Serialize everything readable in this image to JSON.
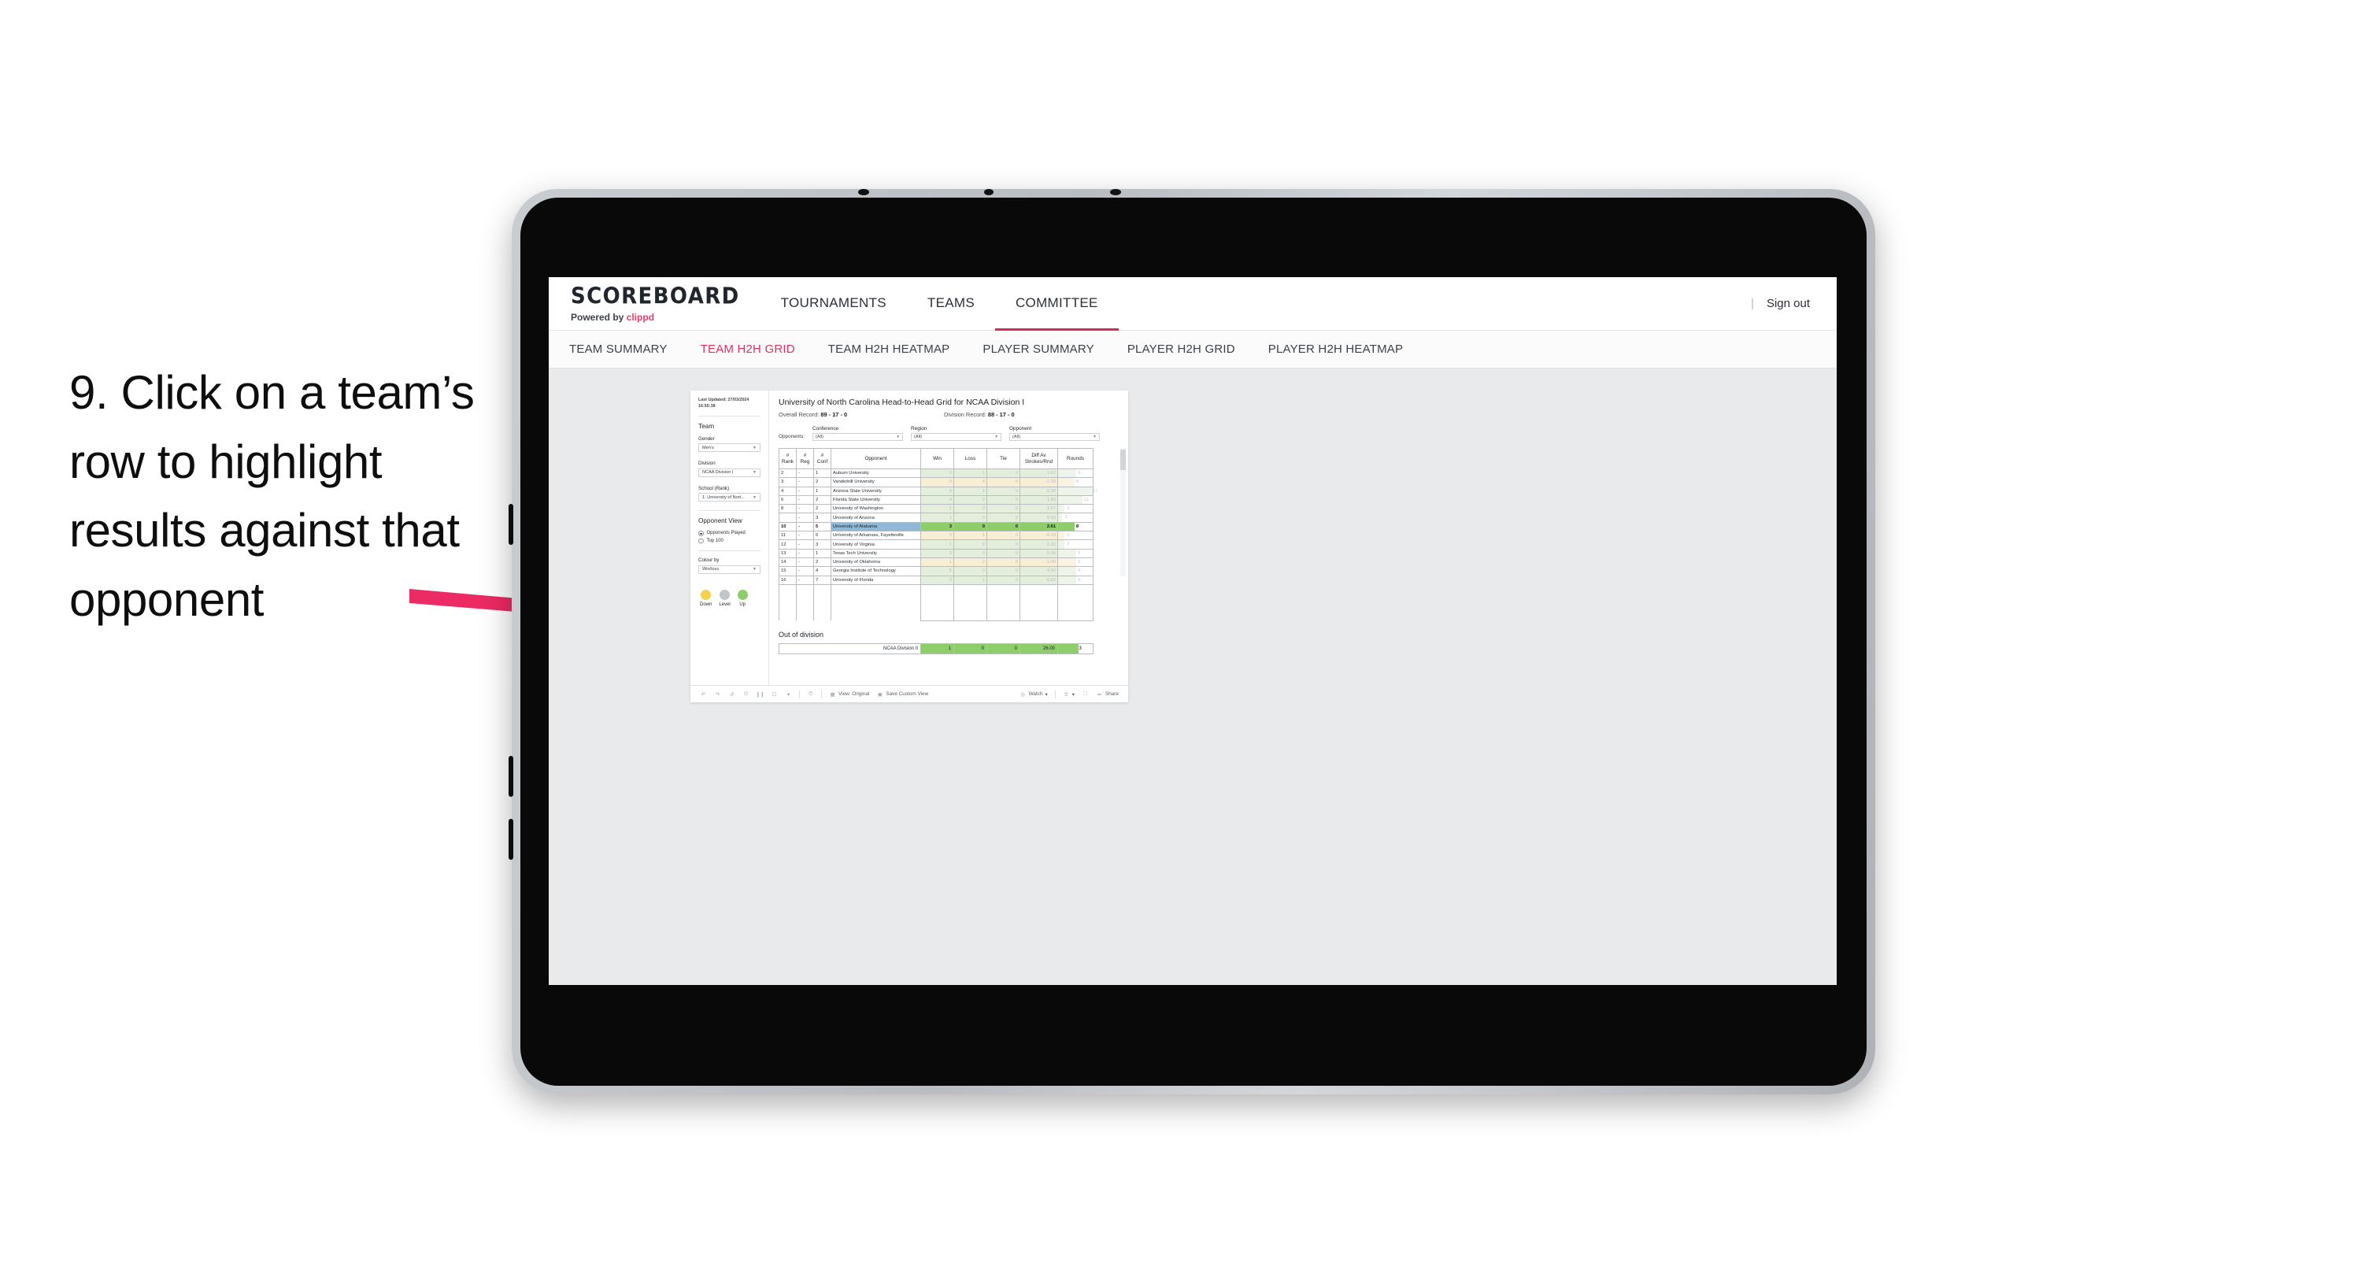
{
  "instruction": "9. Click on a team’s row to highlight results against that opponent",
  "accent": {
    "brand_pink": "#d92a55",
    "arrow_pink": "#ec2a63",
    "select_blue": "#8fb9d6",
    "win_green": "#8ece6a",
    "loss_yellow": "#f4e7c3"
  },
  "topnav": {
    "brand": "SCOREBOARD",
    "powered_prefix": "Powered by ",
    "powered_brand": "clippd",
    "items": [
      {
        "label": "TOURNAMENTS",
        "active": false
      },
      {
        "label": "TEAMS",
        "active": false
      },
      {
        "label": "COMMITTEE",
        "active": true
      }
    ],
    "divider": "|",
    "signout": "Sign out"
  },
  "subnav": {
    "items": [
      {
        "label": "TEAM SUMMARY",
        "active": false
      },
      {
        "label": "TEAM H2H GRID",
        "active": true
      },
      {
        "label": "TEAM H2H HEATMAP",
        "active": false
      },
      {
        "label": "PLAYER SUMMARY",
        "active": false
      },
      {
        "label": "PLAYER H2H GRID",
        "active": false
      },
      {
        "label": "PLAYER H2H HEATMAP",
        "active": false
      }
    ]
  },
  "sidebar": {
    "last_updated_label": "Last Updated:",
    "last_updated_date": "27/03/2024",
    "last_updated_time": "16:55:38",
    "team_section": "Team",
    "gender_label": "Gender",
    "gender_value": "Men’s",
    "division_label": "Division",
    "division_value": "NCAA Division I",
    "school_label": "School (Rank)",
    "school_value": "1. University of Nort...",
    "opponent_view_label": "Opponent View",
    "opponent_view_options": [
      {
        "label": "Opponents Played",
        "selected": true
      },
      {
        "label": "Top 100",
        "selected": false
      }
    ],
    "colour_by_label": "Colour by",
    "colour_by_value": "Win/loss",
    "legend": [
      {
        "label": "Down",
        "color": "#f5d14e"
      },
      {
        "label": "Level",
        "color": "#c3c6c9"
      },
      {
        "label": "Up",
        "color": "#8ece6a"
      }
    ]
  },
  "main": {
    "title": "University of North Carolina Head-to-Head Grid for NCAA Division I",
    "overall_record_label": "Overall Record:",
    "overall_record_value": "89 - 17 - 0",
    "division_record_label": "Division Record:",
    "division_record_value": "88 - 17 - 0",
    "opponents_label": "Opponents:",
    "filters": [
      {
        "label": "Conference",
        "value": "(All)"
      },
      {
        "label": "Region",
        "value": "(All)"
      },
      {
        "label": "Opponent",
        "value": "(All)"
      }
    ],
    "out_of_division_label": "Out of division"
  },
  "chart_data": {
    "type": "table",
    "title": "University of North Carolina Head-to-Head Grid for NCAA Division I",
    "columns": [
      "# Rank",
      "# Reg",
      "# Conf",
      "Opponent",
      "Win",
      "Loss",
      "Tie",
      "Diff Av Strokes/Rnd",
      "Rounds"
    ],
    "column_headers_multiline": [
      [
        "#",
        "Rank"
      ],
      [
        "#",
        "Reg"
      ],
      [
        "#",
        "Conf"
      ],
      [
        "Opponent"
      ],
      [
        "Win"
      ],
      [
        "Loss"
      ],
      [
        "Tie"
      ],
      [
        "Diff Av",
        "Strokes/Rnd"
      ],
      [
        "Rounds"
      ]
    ],
    "rows": [
      {
        "rank": "2",
        "reg": "-",
        "conf": "1",
        "opponent": "Auburn University",
        "win": "2",
        "loss": "1",
        "tie": "0",
        "diff": "1.67",
        "rounds": "9",
        "result": "up",
        "selected": false
      },
      {
        "rank": "3",
        "reg": "-",
        "conf": "2",
        "opponent": "Vanderbilt University",
        "win": "0",
        "loss": "4",
        "tie": "0",
        "diff": "-2.29",
        "rounds": "8",
        "result": "down",
        "selected": false
      },
      {
        "rank": "4",
        "reg": "-",
        "conf": "1",
        "opponent": "Arizona State University",
        "win": "5",
        "loss": "1",
        "tie": "0",
        "diff": "2.28",
        "rounds": "17",
        "result": "up",
        "selected": false
      },
      {
        "rank": "6",
        "reg": "-",
        "conf": "2",
        "opponent": "Florida State University",
        "win": "4",
        "loss": "2",
        "tie": "0",
        "diff": "1.83",
        "rounds": "12",
        "result": "up",
        "selected": false
      },
      {
        "rank": "8",
        "reg": "-",
        "conf": "2",
        "opponent": "University of Washington",
        "win": "1",
        "loss": "0",
        "tie": "0",
        "diff": "3.67",
        "rounds": "3",
        "result": "up",
        "selected": false
      },
      {
        "rank": "",
        "reg": "-",
        "conf": "3",
        "opponent": "University of Arizona",
        "win": "1",
        "loss": "0",
        "tie": "0",
        "diff": "9.00",
        "rounds": "2",
        "result": "up",
        "selected": false
      },
      {
        "rank": "10",
        "reg": "-",
        "conf": "5",
        "opponent": "University of Alabama",
        "win": "3",
        "loss": "0",
        "tie": "0",
        "diff": "2.61",
        "rounds": "8",
        "result": "up",
        "selected": true
      },
      {
        "rank": "11",
        "reg": "-",
        "conf": "6",
        "opponent": "University of Arkansas, Fayetteville",
        "win": "0",
        "loss": "1",
        "tie": "0",
        "diff": "-4.33",
        "rounds": "3",
        "result": "down",
        "selected": false
      },
      {
        "rank": "12",
        "reg": "-",
        "conf": "3",
        "opponent": "University of Virginia",
        "win": "1",
        "loss": "0",
        "tie": "0",
        "diff": "2.33",
        "rounds": "3",
        "result": "up",
        "selected": false
      },
      {
        "rank": "13",
        "reg": "-",
        "conf": "1",
        "opponent": "Texas Tech University",
        "win": "3",
        "loss": "0",
        "tie": "0",
        "diff": "5.56",
        "rounds": "9",
        "result": "up",
        "selected": false
      },
      {
        "rank": "14",
        "reg": "-",
        "conf": "2",
        "opponent": "University of Oklahoma",
        "win": "1",
        "loss": "2",
        "tie": "0",
        "diff": "-1.00",
        "rounds": "9",
        "result": "down",
        "selected": false
      },
      {
        "rank": "15",
        "reg": "-",
        "conf": "4",
        "opponent": "Georgia Institute of Technology",
        "win": "5",
        "loss": "0",
        "tie": "0",
        "diff": "4.50",
        "rounds": "9",
        "result": "up",
        "selected": false
      },
      {
        "rank": "16",
        "reg": "-",
        "conf": "7",
        "opponent": "University of Florida",
        "win": "3",
        "loss": "1",
        "tie": "0",
        "diff": "6.62",
        "rounds": "9",
        "result": "up",
        "selected": false
      }
    ],
    "out_of_division": [
      {
        "opponent": "NCAA Division II",
        "win": "1",
        "loss": "0",
        "tie": "0",
        "diff": "26.00",
        "rounds": "3",
        "result": "up"
      }
    ],
    "max_rounds": 17
  },
  "toolbar": {
    "view_label": "View: Original",
    "save_custom_view": "Save Custom View",
    "watch": "Watch",
    "share": "Share",
    "caret": "▾"
  }
}
